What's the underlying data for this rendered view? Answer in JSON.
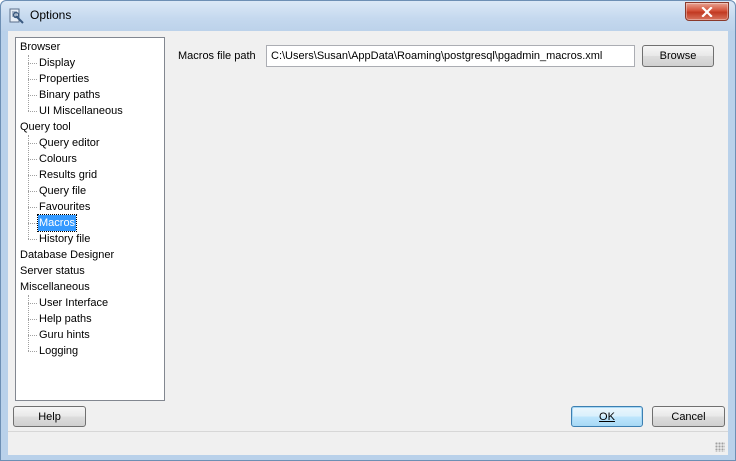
{
  "window": {
    "title": "Options",
    "close_icon": "close-icon"
  },
  "tree": {
    "items": [
      {
        "label": "Browser",
        "level": 0
      },
      {
        "label": "Display",
        "level": 1
      },
      {
        "label": "Properties",
        "level": 1
      },
      {
        "label": "Binary paths",
        "level": 1
      },
      {
        "label": "UI Miscellaneous",
        "level": 1
      },
      {
        "label": "Query tool",
        "level": 0
      },
      {
        "label": "Query editor",
        "level": 1
      },
      {
        "label": "Colours",
        "level": 1
      },
      {
        "label": "Results grid",
        "level": 1
      },
      {
        "label": "Query file",
        "level": 1
      },
      {
        "label": "Favourites",
        "level": 1
      },
      {
        "label": "Macros",
        "level": 1,
        "selected": true
      },
      {
        "label": "History file",
        "level": 1
      },
      {
        "label": "Database Designer",
        "level": 0
      },
      {
        "label": "Server status",
        "level": 0
      },
      {
        "label": "Miscellaneous",
        "level": 0
      },
      {
        "label": "User Interface",
        "level": 1
      },
      {
        "label": "Help paths",
        "level": 1
      },
      {
        "label": "Guru hints",
        "level": 1
      },
      {
        "label": "Logging",
        "level": 1
      }
    ]
  },
  "macros": {
    "label": "Macros file path",
    "value": "C:\\Users\\Susan\\AppData\\Roaming\\postgresql\\pgadmin_macros.xml",
    "browse_label": "Browse"
  },
  "buttons": {
    "help": "Help",
    "ok": "OK",
    "cancel": "Cancel"
  },
  "colors": {
    "selection": "#3399ff",
    "frame": "#b9d1ea"
  }
}
